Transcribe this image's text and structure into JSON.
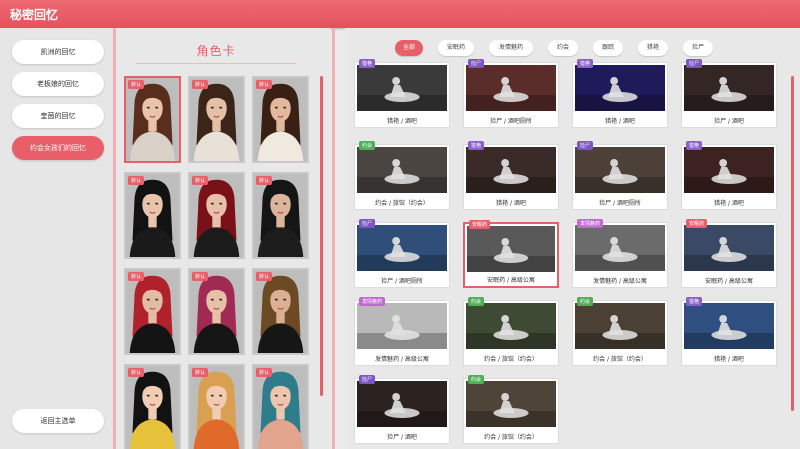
{
  "window": {
    "title": "秘密回忆"
  },
  "menu": {
    "items": [
      {
        "label": "凯洲的回忆",
        "active": false
      },
      {
        "label": "老板娘的回忆",
        "active": false
      },
      {
        "label": "奎茵的回忆",
        "active": false
      },
      {
        "label": "约会女孩们的回忆",
        "active": true
      }
    ],
    "back_label": "返回主选单"
  },
  "cards": {
    "title": "角色卡",
    "tag_label": "默认",
    "items": [
      {
        "hair": "#5a2e1c",
        "skin": "#e9c3aa",
        "outfit": "#d9d0c7",
        "selected": true
      },
      {
        "hair": "#3b2418",
        "skin": "#e6c0a6",
        "outfit": "#e7e1d8",
        "selected": false
      },
      {
        "hair": "#3a2014",
        "skin": "#e2b99f",
        "outfit": "#efe9e0",
        "selected": false
      },
      {
        "hair": "#121212",
        "skin": "#e8c4ae",
        "outfit": "#1a1a1a",
        "selected": false
      },
      {
        "hair": "#7a1018",
        "skin": "#e8c0aa",
        "outfit": "#1b1b1b",
        "selected": false
      },
      {
        "hair": "#151515",
        "skin": "#dcb49c",
        "outfit": "#1d1d1d",
        "selected": false
      },
      {
        "hair": "#b0212b",
        "skin": "#e3bca6",
        "outfit": "#141414",
        "selected": false
      },
      {
        "hair": "#a12a55",
        "skin": "#e7c0a8",
        "outfit": "#151515",
        "selected": false
      },
      {
        "hair": "#6b4a24",
        "skin": "#d9b094",
        "outfit": "#161616",
        "selected": false
      },
      {
        "hair": "#121212",
        "skin": "#efcdb6",
        "outfit": "#e6c23a",
        "selected": false
      },
      {
        "hair": "#d8a050",
        "skin": "#f0cdb2",
        "outfit": "#e06a2a",
        "selected": false
      },
      {
        "hair": "#2f7c8c",
        "skin": "#ecc6ae",
        "outfit": "#e2a48c",
        "selected": false
      }
    ]
  },
  "filters": [
    {
      "label": "全部",
      "active": true
    },
    {
      "label": "安眠药",
      "active": false
    },
    {
      "label": "发情魅药",
      "active": false
    },
    {
      "label": "约会",
      "active": false
    },
    {
      "label": "跟踪",
      "active": false
    },
    {
      "label": "猎艳",
      "active": false
    },
    {
      "label": "捡尸",
      "active": false
    }
  ],
  "tag_colors": {
    "猎艳": "#8b5fc8",
    "捡尸": "#7b56c4",
    "约会": "#4fae58",
    "安眠药": "#e95f69",
    "发情魅药": "#c06ad0"
  },
  "scenes": [
    {
      "tag": "猎艳",
      "caption": "猎艳 / 酒吧",
      "bg": "#3a3a3a",
      "selected": false
    },
    {
      "tag": "捡尸",
      "caption": "捡尸 / 酒吧厕所",
      "bg": "#5a2d2a",
      "selected": false
    },
    {
      "tag": "猎艳",
      "caption": "猎艳 / 酒吧",
      "bg": "#1f1a5a",
      "selected": false
    },
    {
      "tag": "捡尸",
      "caption": "捡尸 / 酒吧",
      "bg": "#332625",
      "selected": false
    },
    {
      "tag": "约会",
      "caption": "约会 / 旅馆（约会）",
      "bg": "#4a4540",
      "selected": false
    },
    {
      "tag": "猎艳",
      "caption": "猎艳 / 酒吧",
      "bg": "#3a2a28",
      "selected": false
    },
    {
      "tag": "捡尸",
      "caption": "捡尸 / 酒吧厕所",
      "bg": "#4d4038",
      "selected": false
    },
    {
      "tag": "猎艳",
      "caption": "猎艳 / 酒吧",
      "bg": "#3c2220",
      "selected": false
    },
    {
      "tag": "捡尸",
      "caption": "捡尸 / 酒吧厕所",
      "bg": "#2f4f7a",
      "selected": false
    },
    {
      "tag": "安眠药",
      "caption": "安眠药 / 高级公寓",
      "bg": "#595959",
      "selected": true
    },
    {
      "tag": "发情魅药",
      "caption": "发情魅药 / 高级公寓",
      "bg": "#6b6b6b",
      "selected": false
    },
    {
      "tag": "安眠药",
      "caption": "安眠药 / 高级公寓",
      "bg": "#3a4a66",
      "selected": false
    },
    {
      "tag": "发情魅药",
      "caption": "发情魅药 / 高级公寓",
      "bg": "#b9b9b9",
      "selected": false
    },
    {
      "tag": "约会",
      "caption": "约会 / 旅馆（约会）",
      "bg": "#3e4a34",
      "selected": false
    },
    {
      "tag": "约会",
      "caption": "约会 / 旅馆（约会）",
      "bg": "#4a4034",
      "selected": false
    },
    {
      "tag": "猎艳",
      "caption": "猎艳 / 酒吧",
      "bg": "#2e4f80",
      "selected": false
    },
    {
      "tag": "捡尸",
      "caption": "捡尸 / 酒吧",
      "bg": "#2c2220",
      "selected": false
    },
    {
      "tag": "约会",
      "caption": "约会 / 旅馆（约会）",
      "bg": "#4f4438",
      "selected": false
    }
  ]
}
